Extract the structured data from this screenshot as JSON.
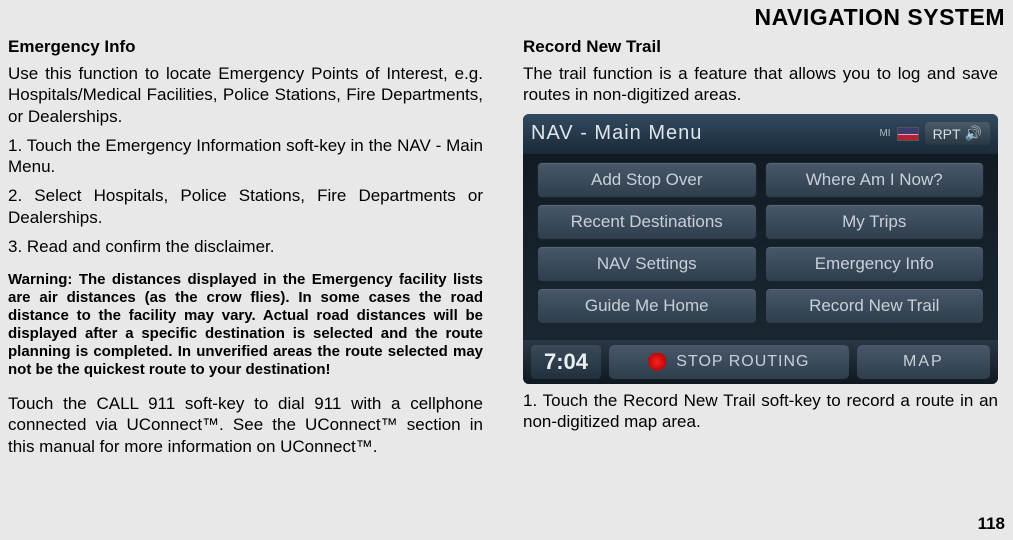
{
  "header": "NAVIGATION SYSTEM",
  "page_number": "118",
  "left": {
    "heading": "Emergency Info",
    "p1": "Use this function to locate Emergency Points of Interest, e.g. Hospitals/Medical Facilities, Police Stations, Fire Departments, or Dealerships.",
    "p2": "1. Touch the Emergency Information soft-key in the NAV - Main Menu.",
    "p3": "2. Select Hospitals, Police Stations, Fire Departments or Dealerships.",
    "p4": "3. Read and confirm the disclaimer.",
    "warning": "Warning: The distances displayed in the Emergency facility lists are air distances (as the crow flies). In some cases the road distance to the facility may vary. Actual road distances will be displayed after a specific destination is selected and the route planning is completed. In unverified areas the route selected may not be the quickest route to your destination!",
    "p5": "Touch the CALL 911 soft-key to dial 911 with a cellphone connected via UConnect™. See the UConnect™ section in this manual for more information on UConnect™."
  },
  "right": {
    "heading": "Record New Trail",
    "p1": "The trail function is a feature that allows you to log and save routes in non-digitized areas.",
    "p2": "1. Touch the Record New Trail soft-key to record a route in an non-digitized map area."
  },
  "nav": {
    "title": "NAV - Main Menu",
    "unit": "MI",
    "rpt": "RPT",
    "buttons": [
      "Add Stop Over",
      "Where Am I Now?",
      "Recent Destinations",
      "My Trips",
      "NAV Settings",
      "Emergency Info",
      "Guide Me Home",
      "Record New Trail"
    ],
    "clock": "7:04",
    "stop_routing": "STOP ROUTING",
    "map": "MAP"
  }
}
